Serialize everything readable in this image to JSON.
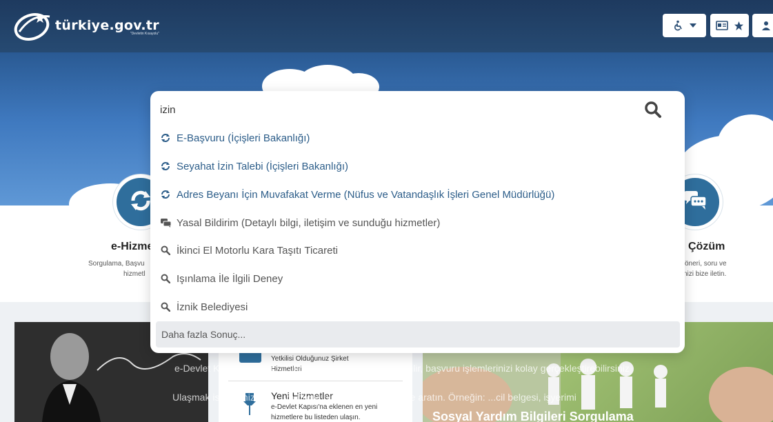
{
  "header": {
    "logo_title": "türkiye.gov.tr",
    "logo_subtitle": "\"Devletin Kısayolu\"",
    "accessibility_button": "accessibility-menu",
    "id_card_button": "favorites-and-id"
  },
  "search": {
    "value": "izin",
    "suggestions": [
      {
        "label": "E-Başvuru (İçişleri Bakanlığı)",
        "icon": "refresh-icon",
        "kind": "service"
      },
      {
        "label": "Seyahat İzin Talebi (İçişleri Bakanlığı)",
        "icon": "refresh-icon",
        "kind": "service"
      },
      {
        "label": "Adres Beyanı İçin Muvafakat Verme (Nüfus ve Vatandaşlık İşleri Genel Müdürlüğü)",
        "icon": "refresh-icon",
        "kind": "service"
      },
      {
        "label": "Yasal Bildirim (Detaylı bilgi, iletişim ve sunduğu hizmetler)",
        "icon": "chat-icon",
        "kind": "info"
      },
      {
        "label": "İkinci El Motorlu Kara Taşıtı Ticareti",
        "icon": "search-icon",
        "kind": "search"
      },
      {
        "label": "Işınlama İle İlgili Deney",
        "icon": "search-icon",
        "kind": "search"
      },
      {
        "label": "İznik Belediyesi",
        "icon": "search-icon",
        "kind": "search"
      }
    ],
    "more_label": "Daha fazla Sonuç..."
  },
  "band": {
    "left_title": "e-Hizme",
    "left_text_1": "Sorgulama, Başvu",
    "left_text_2": "hizmetl",
    "right_title": "Çözüm",
    "right_text_1": "öneri, soru ve",
    "right_text_2": "nizi bize iletin."
  },
  "cards": {
    "mid_item1_text_1": "Yetkilisi Olduğunuz Şirket",
    "mid_item1_text_2": "Hizmetleri",
    "mid_item2_title": "Yeni Hizmetler",
    "mid_item2_text_1": "e-Devlet Kapısı'na eklenen en yeni",
    "mid_item2_text_2": "hizmetlere bu listeden ulaşın.",
    "photo_title": "Sosyal Yardım Bilgileri Sorgulama",
    "overlay_line_1": "e-Devlet Kapısı ile bilgi... ...lerinize tek noktadan ulaşabilir, başvuru işlemlerinizi kolay gerçekleştirebilirsiniz",
    "overlay_line_2": "Ulaşmak istediğiniz hi... ...ya bilgiyi birkaç basit kelime ile aratın. Örneğin: ...cil belgesi, işyerimi"
  },
  "colors": {
    "header_bg": "#1e3a5f",
    "link": "#2c5d89",
    "circle": "#2f6e9c"
  }
}
